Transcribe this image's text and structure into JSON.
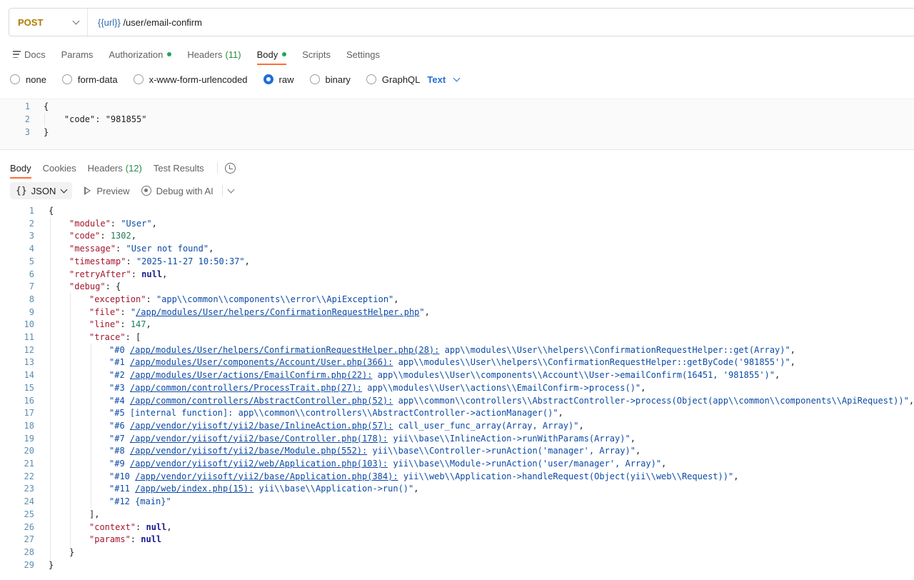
{
  "request": {
    "method": "POST",
    "url_var": "{{url}}",
    "url_path": " /user/email-confirm"
  },
  "request_tabs": [
    {
      "label": "Docs"
    },
    {
      "label": "Params"
    },
    {
      "label": "Authorization"
    },
    {
      "label": "Headers",
      "count": "(11)"
    },
    {
      "label": "Body"
    },
    {
      "label": "Scripts"
    },
    {
      "label": "Settings"
    }
  ],
  "body_types": {
    "none": "none",
    "form_data": "form-data",
    "urlencoded": "x-www-form-urlencoded",
    "raw": "raw",
    "binary": "binary",
    "graphql": "GraphQL",
    "text_select": "Text"
  },
  "request_body": {
    "line_numbers": [
      "1",
      "2",
      "3"
    ],
    "lines": [
      "{",
      "    \"code\": \"981855\"",
      "}"
    ]
  },
  "response_tabs": [
    {
      "label": "Body"
    },
    {
      "label": "Cookies"
    },
    {
      "label": "Headers",
      "count": "(12)"
    },
    {
      "label": "Test Results"
    }
  ],
  "response_toolbar": {
    "format": "JSON",
    "braces": "{}",
    "preview": "Preview",
    "debug": "Debug with AI"
  },
  "response": {
    "line_numbers": [
      "1",
      "2",
      "3",
      "4",
      "5",
      "6",
      "7",
      "8",
      "9",
      "10",
      "11",
      "12",
      "13",
      "14",
      "15",
      "16",
      "17",
      "18",
      "19",
      "20",
      "21",
      "22",
      "23",
      "24",
      "25",
      "26",
      "27",
      "28",
      "29"
    ],
    "module_key": "\"module\"",
    "module_val": "\"User\"",
    "code_key": "\"code\"",
    "code_val": "1302",
    "message_key": "\"message\"",
    "message_val": "\"User not found\"",
    "timestamp_key": "\"timestamp\"",
    "timestamp_val": "\"2025-11-27 10:50:37\"",
    "retry_key": "\"retryAfter\"",
    "retry_val": "null",
    "debug_key": "\"debug\"",
    "exception_key": "\"exception\"",
    "exception_val": "\"app\\\\common\\\\components\\\\error\\\\ApiException\"",
    "file_key": "\"file\"",
    "file_val": "/app/modules/User/helpers/ConfirmationRequestHelper.php",
    "line_key": "\"line\"",
    "line_val": "147",
    "trace_key": "\"trace\"",
    "trace": [
      {
        "prefix": "\"#0 ",
        "link": "/app/modules/User/helpers/ConfirmationRequestHelper.php(28):",
        "rest": " app\\\\modules\\\\User\\\\helpers\\\\ConfirmationRequestHelper::get(Array)\""
      },
      {
        "prefix": "\"#1 ",
        "link": "/app/modules/User/components/Account/User.php(366):",
        "rest": " app\\\\modules\\\\User\\\\helpers\\\\ConfirmationRequestHelper::getByCode('981855')\""
      },
      {
        "prefix": "\"#2 ",
        "link": "/app/modules/User/actions/EmailConfirm.php(22):",
        "rest": " app\\\\modules\\\\User\\\\components\\\\Account\\\\User->emailConfirm(16451, '981855')\""
      },
      {
        "prefix": "\"#3 ",
        "link": "/app/common/controllers/ProcessTrait.php(27):",
        "rest": " app\\\\modules\\\\User\\\\actions\\\\EmailConfirm->process()\""
      },
      {
        "prefix": "\"#4 ",
        "link": "/app/common/controllers/AbstractController.php(52):",
        "rest": " app\\\\common\\\\controllers\\\\AbstractController->process(Object(app\\\\common\\\\components\\\\ApiRequest))\""
      },
      {
        "prefix": "\"#5 [internal function]: app\\\\common\\\\controllers\\\\AbstractController->actionManager()\"",
        "link": "",
        "rest": ""
      },
      {
        "prefix": "\"#6 ",
        "link": "/app/vendor/yiisoft/yii2/base/InlineAction.php(57):",
        "rest": " call_user_func_array(Array, Array)\""
      },
      {
        "prefix": "\"#7 ",
        "link": "/app/vendor/yiisoft/yii2/base/Controller.php(178):",
        "rest": " yii\\\\base\\\\InlineAction->runWithParams(Array)\""
      },
      {
        "prefix": "\"#8 ",
        "link": "/app/vendor/yiisoft/yii2/base/Module.php(552):",
        "rest": " yii\\\\base\\\\Controller->runAction('manager', Array)\""
      },
      {
        "prefix": "\"#9 ",
        "link": "/app/vendor/yiisoft/yii2/web/Application.php(103):",
        "rest": " yii\\\\base\\\\Module->runAction('user/manager', Array)\""
      },
      {
        "prefix": "\"#10 ",
        "link": "/app/vendor/yiisoft/yii2/base/Application.php(384):",
        "rest": " yii\\\\web\\\\Application->handleRequest(Object(yii\\\\web\\\\Request))\""
      },
      {
        "prefix": "\"#11 ",
        "link": "/app/web/index.php(15):",
        "rest": " yii\\\\base\\\\Application->run()\""
      },
      {
        "prefix": "\"#12 {main}\"",
        "link": "",
        "rest": ""
      }
    ],
    "context_key": "\"context\"",
    "context_val": "null",
    "params_key": "\"params\"",
    "params_val": "null"
  },
  "colors": {
    "accent": "#ff6c37",
    "method": "#b07a00",
    "radio_on": "#1f6fd6",
    "count": "#2a8c46",
    "json_key": "#a3152c",
    "json_string": "#0c4aa6",
    "json_number": "#207a5a"
  },
  "icons": [
    "chevron-down-icon",
    "docs-icon",
    "status-dot-icon",
    "history-icon",
    "play-icon",
    "ai-icon",
    "braces-icon"
  ]
}
